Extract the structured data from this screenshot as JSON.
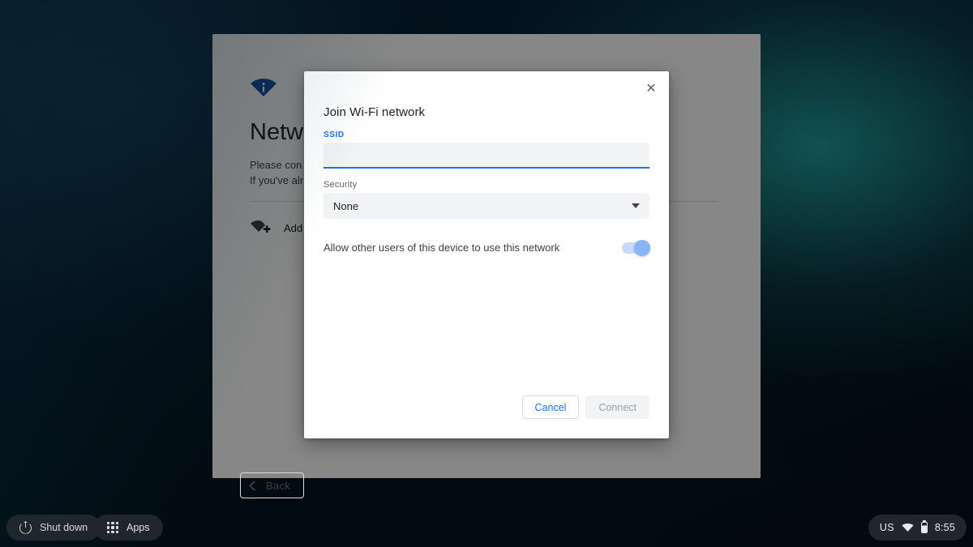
{
  "desktop": {
    "wallpaper_colors": {
      "base": "#03121c",
      "teal_glow": "#125654",
      "deep_shadow": "#01080f"
    }
  },
  "oobe": {
    "icon": "wifi-info-icon",
    "title": "Netw",
    "description_line1": "Please con",
    "description_line2": "If you've alr",
    "network_list": [
      {
        "icon": "wifi-add-icon",
        "label": "Add"
      }
    ],
    "back_button": {
      "label": "Back",
      "icon": "chevron-left-icon"
    }
  },
  "dialog": {
    "title": "Join Wi-Fi network",
    "close_icon": "close-icon",
    "ssid": {
      "label": "SSID",
      "value": "",
      "placeholder": ""
    },
    "security": {
      "label": "Security",
      "selected": "None",
      "options": [
        "None"
      ]
    },
    "share_toggle": {
      "label": "Allow other users of this device to use this network",
      "state": "on"
    },
    "buttons": {
      "cancel": "Cancel",
      "connect": "Connect"
    },
    "colors": {
      "accent": "#1a73e8",
      "field_bg": "#f1f3f4",
      "toggle_on_track": "#c6dafc",
      "toggle_on_knob": "#8ab4f8",
      "disabled_text": "#9aa0a6"
    }
  },
  "shelf": {
    "shutdown": {
      "label": "Shut down",
      "icon": "power-icon"
    },
    "apps": {
      "label": "Apps",
      "icon": "apps-grid-icon"
    },
    "tray": {
      "ime": "US",
      "wifi_icon": "wifi-icon",
      "battery_icon": "battery-icon",
      "clock": "8:55"
    }
  }
}
